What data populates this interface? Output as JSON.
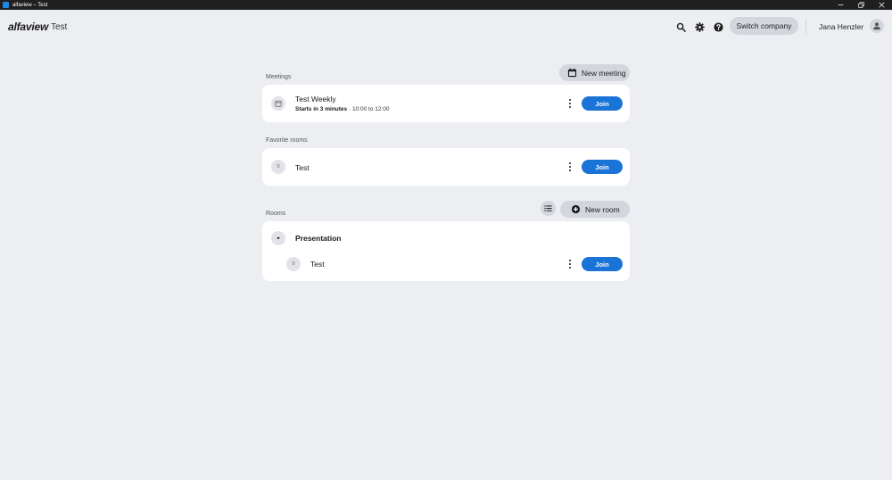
{
  "window": {
    "title": "alfaview – Test"
  },
  "header": {
    "brand": "alfaview",
    "company": "Test",
    "icons": [
      "search-icon",
      "gear-icon",
      "help-icon"
    ],
    "switch_company_label": "Switch company",
    "user_name": "Jana Henzler",
    "avatar_icon": "person-icon"
  },
  "meetings": {
    "label": "Meetings",
    "new_meeting_label": "New meeting",
    "items": [
      {
        "title": "Test Weekly",
        "starts": "Starts in 3 minutes",
        "time": "· 10:00 to 12:00",
        "join_label": "Join",
        "icon": "calendar-icon"
      }
    ]
  },
  "favorites": {
    "label": "Favorite rooms",
    "items": [
      {
        "count": "0",
        "title": "Test",
        "join_label": "Join"
      }
    ]
  },
  "rooms": {
    "label": "Rooms",
    "new_room_label": "New room",
    "list_icon": "list-view-icon",
    "groups": [
      {
        "title": "Presentation",
        "expanded": true,
        "items": [
          {
            "count": "0",
            "title": "Test",
            "join_label": "Join"
          }
        ]
      }
    ]
  },
  "colors": {
    "background": "#eceef2",
    "card": "#ffffff",
    "accent": "#1a73d6",
    "pill": "#d3d6dd",
    "titlebar": "#1f1f1f"
  }
}
